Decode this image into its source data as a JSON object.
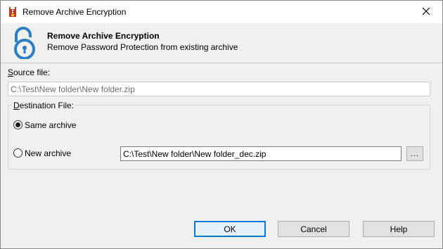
{
  "window": {
    "title": "Remove Archive Encryption",
    "icon": "archive-app-icon",
    "close_icon": "close-icon"
  },
  "header": {
    "icon": "unlock-icon",
    "icon_color": "#2b7fc2",
    "title": "Remove Archive Encryption",
    "subtitle": "Remove Password Protection from existing archive"
  },
  "source": {
    "label_prefix": "S",
    "label_rest": "ource file:",
    "value": "C:\\Test\\New folder\\New folder.zip"
  },
  "destination": {
    "group_label_prefix": "D",
    "group_label_rest": "estination File:",
    "same_archive_label": "Same archive",
    "same_archive_selected": true,
    "new_archive_label": "New archive",
    "new_archive_selected": false,
    "new_archive_path": "C:\\Test\\New folder\\New folder_dec.zip",
    "browse_label": "..."
  },
  "buttons": {
    "ok": "OK",
    "cancel": "Cancel",
    "help": "Help"
  },
  "colors": {
    "accent": "#0078d7",
    "dialog_bg": "#f0f0f0"
  }
}
